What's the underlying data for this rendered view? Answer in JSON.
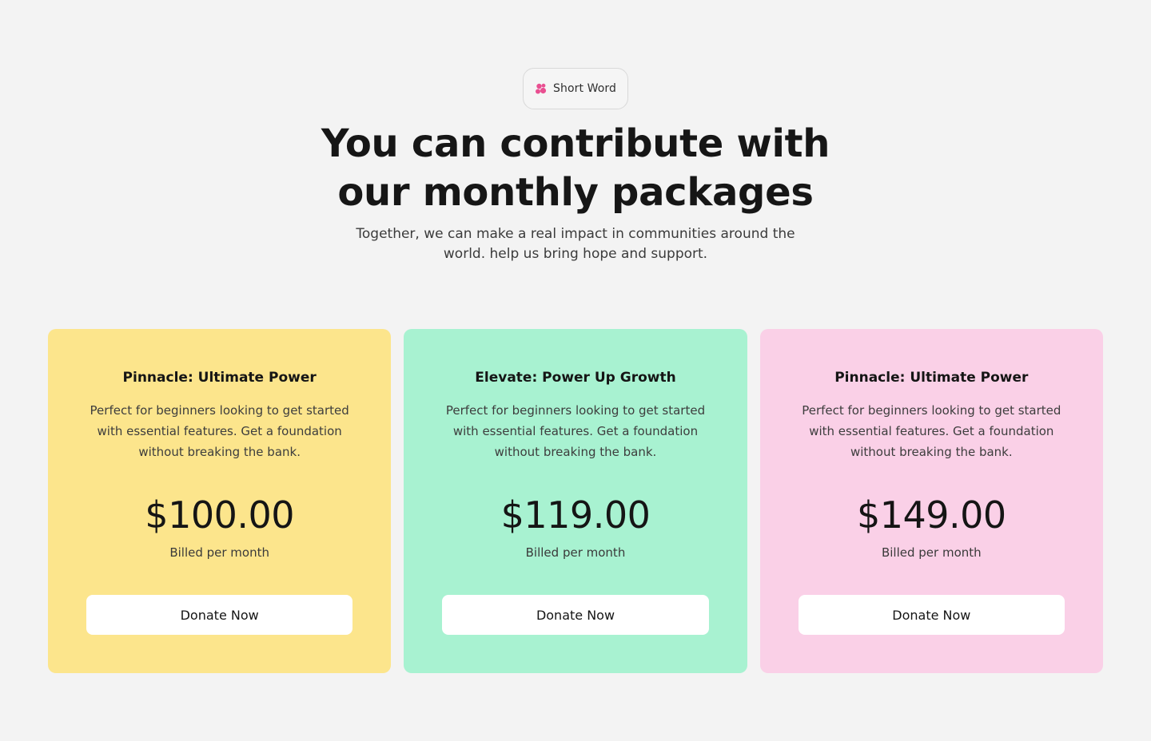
{
  "badge": {
    "label": "Short Word",
    "icon": "people-icon",
    "icon_color": "#e94f91"
  },
  "hero": {
    "title_line1": "You can contribute with",
    "title_line2": "our monthly packages",
    "subtitle_line1": "Together, we can make a real impact in communities around the",
    "subtitle_line2": "world. help us bring hope and support."
  },
  "plans": [
    {
      "name": "Pinnacle: Ultimate Power",
      "description": "Perfect for beginners looking to get started with essential features. Get a foundation without breaking the bank.",
      "price": "$100.00",
      "billing": "Billed per month",
      "button_label": "Donate Now",
      "background": "#fce58c"
    },
    {
      "name": "Elevate: Power Up Growth",
      "description": "Perfect for beginners looking to get started with essential features. Get a foundation without breaking the bank.",
      "price": "$119.00",
      "billing": "Billed per month",
      "button_label": "Donate Now",
      "background": "#a8f2d1"
    },
    {
      "name": "Pinnacle: Ultimate Power",
      "description": "Perfect for beginners looking to get started with essential features. Get a foundation without breaking the bank.",
      "price": "$149.00",
      "billing": "Billed per month",
      "button_label": "Donate Now",
      "background": "#fad0e7"
    }
  ]
}
